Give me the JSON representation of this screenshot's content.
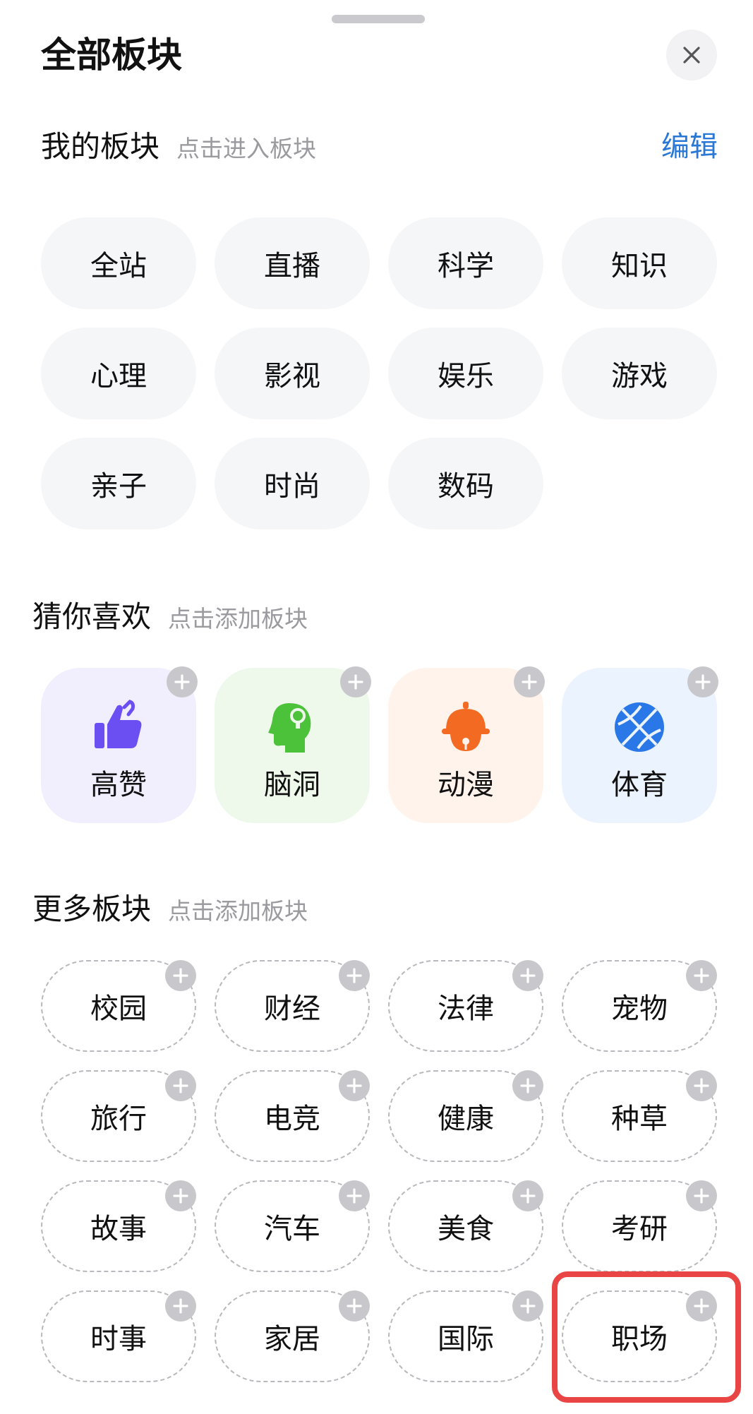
{
  "sheet": {
    "title": "全部板块",
    "close_icon": "close-icon"
  },
  "my_sections": {
    "name": "我的板块",
    "hint": "点击进入板块",
    "edit_label": "编辑",
    "edit_color": "#2a78d6",
    "items": [
      "全站",
      "直播",
      "科学",
      "知识",
      "心理",
      "影视",
      "娱乐",
      "游戏",
      "亲子",
      "时尚",
      "数码"
    ]
  },
  "recommended": {
    "name": "猜你喜欢",
    "hint": "点击添加板块",
    "items": [
      {
        "label": "高赞",
        "icon": "thumbs-up-icon",
        "bg": "#f1effe",
        "color": "#6b4ff2"
      },
      {
        "label": "脑洞",
        "icon": "brain-head-icon",
        "bg": "#eef9ec",
        "color": "#4cc23a"
      },
      {
        "label": "动漫",
        "icon": "bell-icon",
        "bg": "#fff3ec",
        "color": "#f36b22"
      },
      {
        "label": "体育",
        "icon": "basketball-icon",
        "bg": "#ebf3fe",
        "color": "#2a78e8"
      }
    ]
  },
  "more_sections": {
    "name": "更多板块",
    "hint": "点击添加板块",
    "items": [
      "校园",
      "财经",
      "法律",
      "宠物",
      "旅行",
      "电竞",
      "健康",
      "种草",
      "故事",
      "汽车",
      "美食",
      "考研",
      "时事",
      "家居",
      "国际",
      "职场"
    ],
    "highlighted": "职场",
    "highlight_color": "#e94545"
  }
}
